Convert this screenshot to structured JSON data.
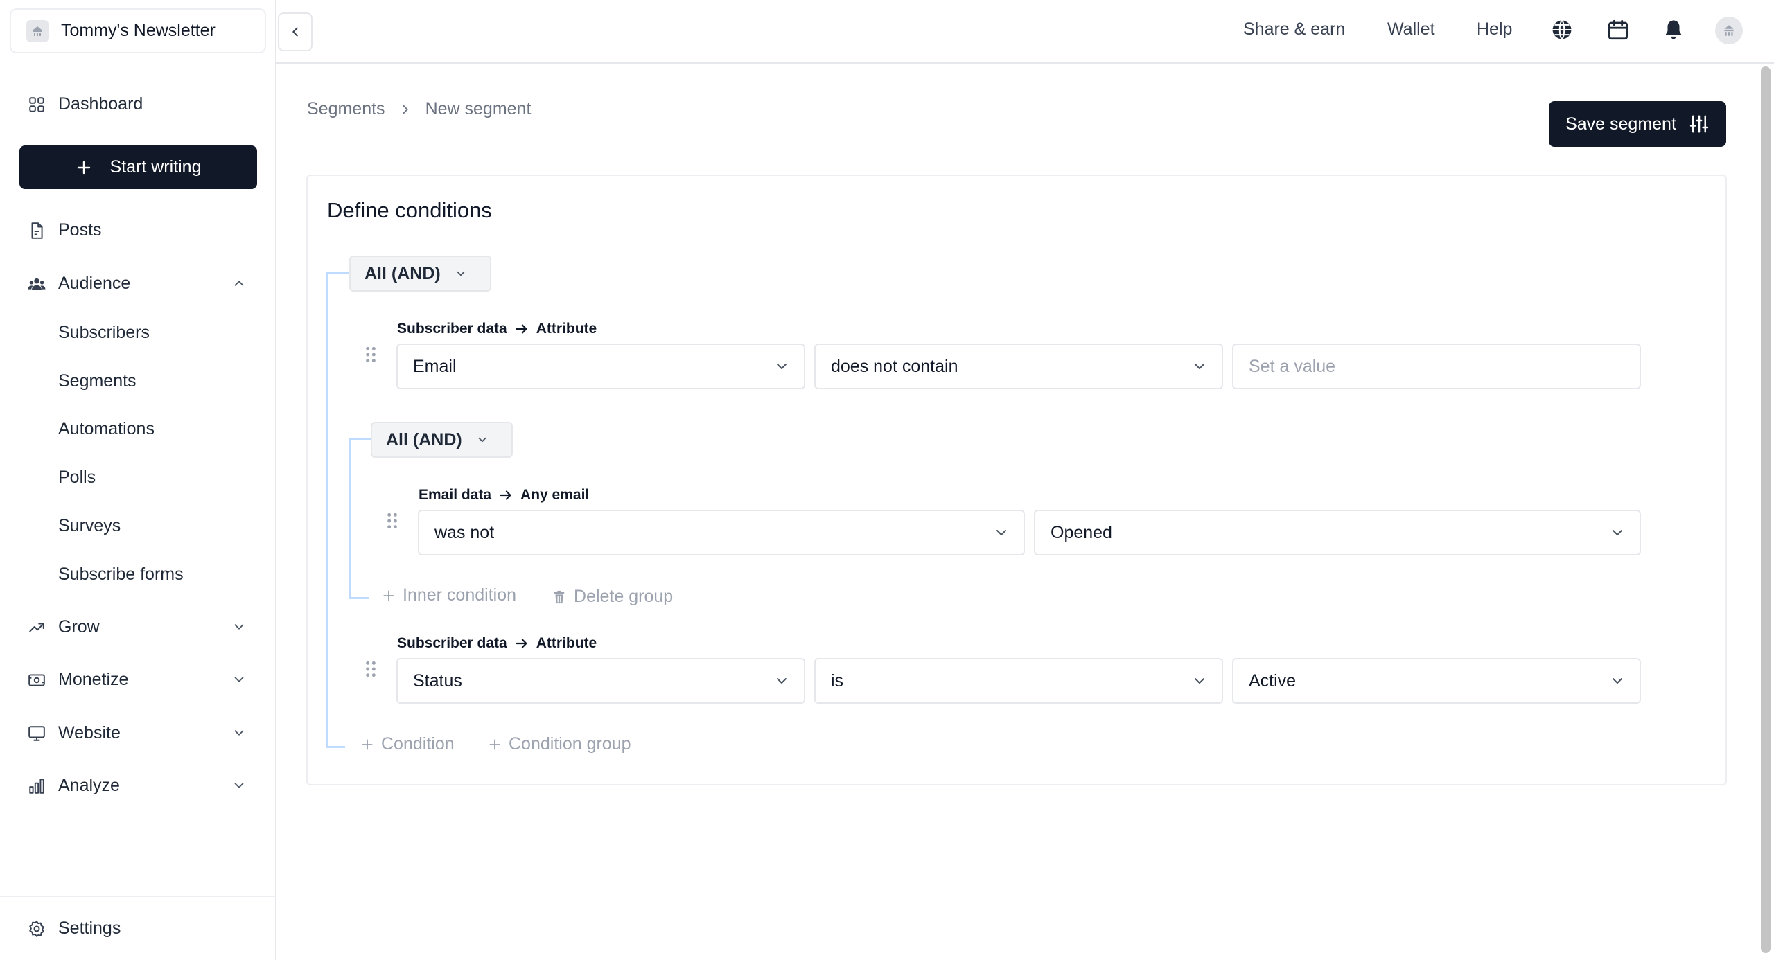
{
  "publication": {
    "name": "Tommy's Newsletter",
    "logo_icon": "publication-logo-icon"
  },
  "sidebar": {
    "dashboard": "Dashboard",
    "start_writing": "Start writing",
    "posts": "Posts",
    "audience": "Audience",
    "audience_items": [
      "Subscribers",
      "Segments",
      "Automations",
      "Polls",
      "Surveys",
      "Subscribe forms"
    ],
    "grow": "Grow",
    "monetize": "Monetize",
    "website": "Website",
    "analyze": "Analyze",
    "settings": "Settings"
  },
  "topbar": {
    "share_earn": "Share & earn",
    "wallet": "Wallet",
    "help": "Help",
    "icons": [
      "globe-icon",
      "calendar-icon",
      "bell-icon",
      "avatar"
    ]
  },
  "breadcrumb": {
    "parent": "Segments",
    "current": "New segment"
  },
  "save_button": "Save segment",
  "builder": {
    "title": "Define conditions",
    "root_operator": "All (AND)",
    "condition1": {
      "source": "Subscriber data",
      "target": "Attribute",
      "field": "Email",
      "operator": "does not contain",
      "value_placeholder": "Set a value"
    },
    "inner_group": {
      "operator": "All (AND)",
      "condition": {
        "source": "Email data",
        "target": "Any email",
        "operator": "was not",
        "value": "Opened"
      },
      "inner_condition": "Inner condition",
      "delete_group": "Delete group"
    },
    "condition2": {
      "source": "Subscriber data",
      "target": "Attribute",
      "field": "Status",
      "operator": "is",
      "value": "Active"
    },
    "add_condition": "Condition",
    "add_condition_group": "Condition group"
  },
  "colors": {
    "primary_dark": "#111827",
    "tree_line": "#bfdbfe",
    "muted_text": "#9ca3af",
    "border": "#e5e7eb"
  }
}
